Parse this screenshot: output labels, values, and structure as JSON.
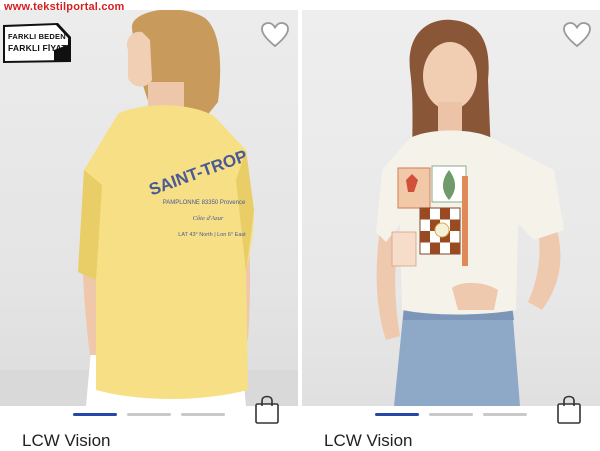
{
  "watermark": "www.tekstilportal.com",
  "products": [
    {
      "badge": {
        "line1": "FARKLI BEDEN",
        "line2": "FARKLI FİYAT"
      },
      "print_text": {
        "title": "SAINT-TROP",
        "line1": "PAMPLONNE 83350 Provence",
        "line2": "Côte d'Azur",
        "line3": "LAT 43° North | Lon 6° East"
      },
      "colors": {
        "shirt": "#f6df84",
        "shirt_shadow": "#e9cd66",
        "print": "#4a5a95"
      },
      "icons": {
        "favorite": "heart-outline-icon",
        "bag": "shopping-bag-icon"
      },
      "carousel": {
        "count": 3,
        "active": 1
      },
      "brand": "LCW Vision"
    },
    {
      "colors": {
        "shirt": "#f5f2ea",
        "skirt": "#8ea8c8",
        "hair": "#8a5638"
      },
      "icons": {
        "favorite": "heart-outline-icon",
        "bag": "shopping-bag-icon"
      },
      "carousel": {
        "count": 3,
        "active": 1
      },
      "brand": "LCW Vision"
    }
  ]
}
